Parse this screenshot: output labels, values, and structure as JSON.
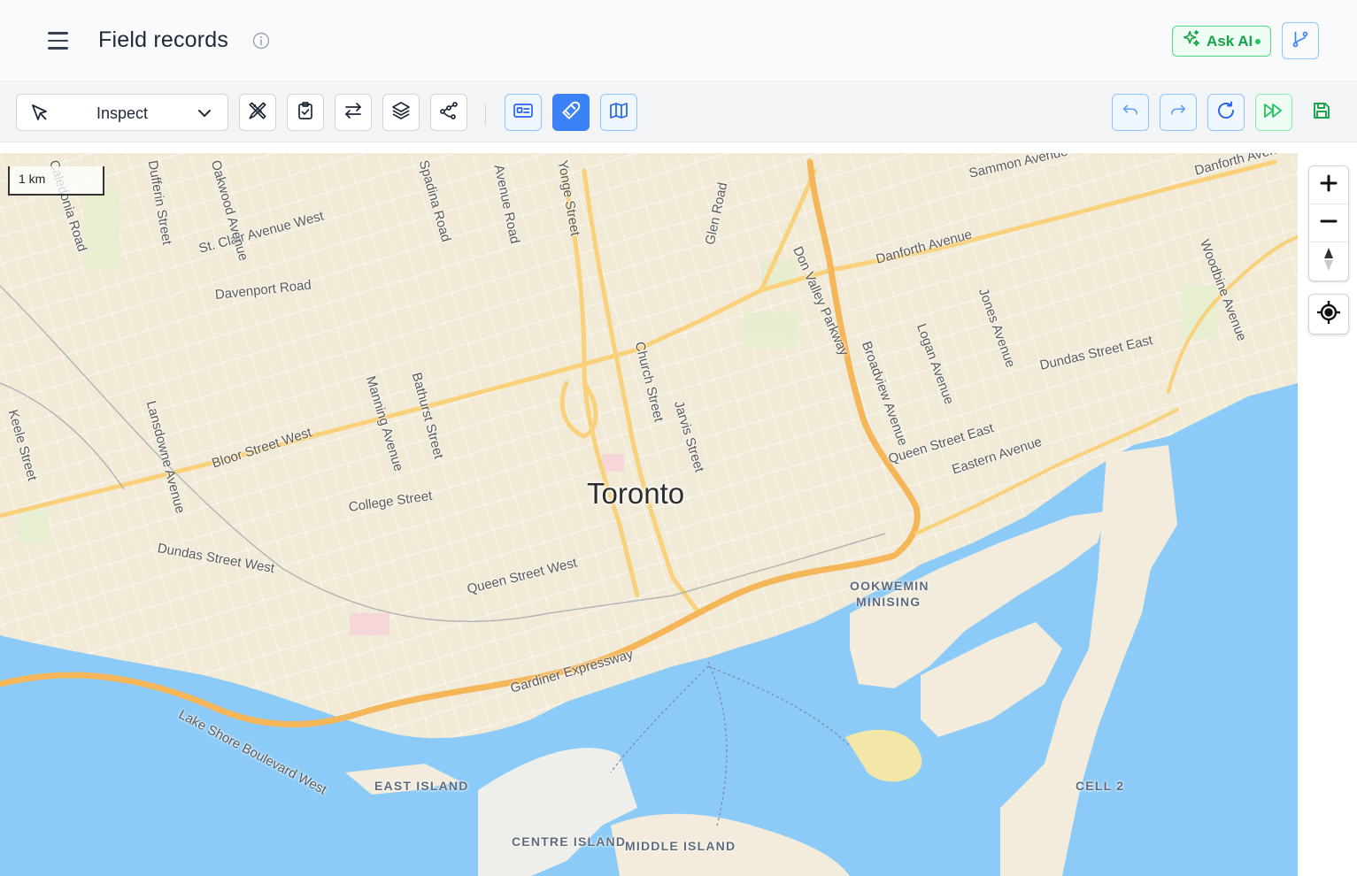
{
  "header": {
    "title": "Field records",
    "ask_ai_label": "Ask AI"
  },
  "toolbar": {
    "mode_label": "Inspect",
    "active_button": "magnet"
  },
  "map": {
    "scale_label": "1 km",
    "city_label": "Toronto",
    "street_labels": [
      "St. Clair Avenue West",
      "Davenport Road",
      "Bloor Street West",
      "College Street",
      "Dundas Street West",
      "Queen Street West",
      "Gardiner Expressway",
      "Lake Shore Boulevard West",
      "Keele Street",
      "Lansdowne Avenue",
      "Manning Avenue",
      "Bathurst Street",
      "Church Street",
      "Jarvis Street",
      "Glen Road",
      "Don Valley Parkway",
      "Broadview Avenue",
      "Logan Avenue",
      "Jones Avenue",
      "Woodbine Avenue",
      "Danforth Avenue",
      "Sammon Avenue",
      "Danforth Avenue",
      "Dundas Street East",
      "Queen Street East",
      "Eastern Avenue",
      "Avenue Road",
      "Caledonia Road",
      "Dufferin Street",
      "Oakwood Avenue",
      "Spadina Road",
      "Yonge Street"
    ],
    "water_labels": [
      "OOKWEMIN",
      "MINISING",
      "EAST ISLAND",
      "CENTRE ISLAND",
      "MIDDLE ISLAND",
      "CELL 2"
    ]
  },
  "colors": {
    "accent_blue": "#3b82f6",
    "ai_green": "#16a34a",
    "water": "#8ccbf7",
    "land": "#f3ecdc",
    "major_road": "#f9d27a",
    "highway": "#f5b65a"
  }
}
